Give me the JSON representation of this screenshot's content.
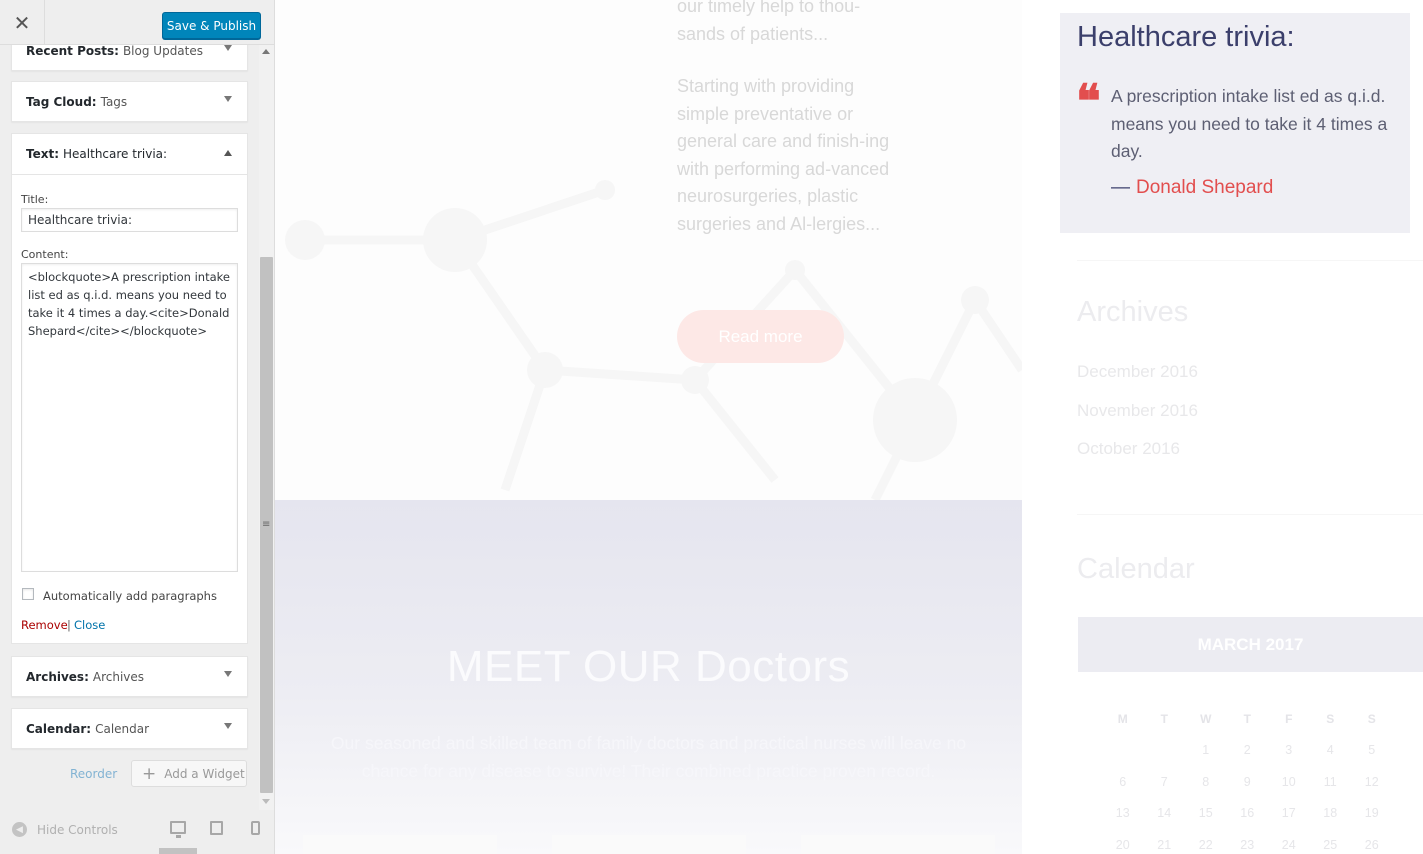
{
  "topbar": {
    "close_glyph": "✕",
    "save_label": "Save & Publish"
  },
  "widgets": {
    "recent_posts": {
      "type": "Recent Posts:",
      "title": "Blog Updates"
    },
    "tag_cloud": {
      "type": "Tag Cloud:",
      "title": "Tags"
    },
    "text": {
      "type": "Text:",
      "title": "Healthcare trivia:",
      "title_label": "Title:",
      "title_value": "Healthcare trivia:",
      "content_label": "Content:",
      "content_value": "<blockquote>A prescription intake list ed as q.i.d. means you need to take it 4 times a day.<cite>Donald Shepard</cite></blockquote>",
      "auto_paragraphs_label": "Automatically add paragraphs",
      "auto_paragraphs_checked": false,
      "remove_label": "Remove",
      "separator": "|",
      "close_label": "Close"
    },
    "archives": {
      "type": "Archives:",
      "title": "Archives"
    },
    "calendar": {
      "type": "Calendar:",
      "title": "Calendar"
    }
  },
  "actions": {
    "reorder_label": "Reorder",
    "add_widget_label": "Add a Widget"
  },
  "footer": {
    "hide_controls_label": "Hide Controls",
    "devices": [
      "desktop-icon",
      "tablet-icon",
      "mobile-icon"
    ],
    "active_device": "desktop"
  },
  "preview": {
    "intro_tail": "our timely help to thou-sands of patients...",
    "intro_body": "Starting with providing simple preventative or general care and finish-ing with performing ad-vanced neurosurgeries, plastic surgeries and Al-lergies...",
    "read_more_label": "Read more",
    "doctors_title": "MEET OUR Doctors",
    "doctors_desc": "Our seasoned and skilled team of family doctors and practical nurses will leave no chance for any disease to survive! Their combined practice proven record.",
    "trivia": {
      "title": "Healthcare trivia:",
      "quote_glyph": "❝",
      "quote": "A prescription intake list ed as q.i.d. means you need to take it 4 times a day.",
      "cite_dash": "—",
      "cite": "Donald Shepard"
    },
    "archives": {
      "title": "Archives",
      "items": [
        "December 2016",
        "November 2016",
        "October 2016"
      ]
    },
    "calendar": {
      "title": "Calendar",
      "month": "MARCH 2017",
      "weekdays": [
        "M",
        "T",
        "W",
        "T",
        "F",
        "S",
        "S"
      ],
      "weeks": [
        [
          "",
          "",
          "1",
          "2",
          "3",
          "4",
          "5"
        ],
        [
          "6",
          "7",
          "8",
          "9",
          "10",
          "11",
          "12"
        ],
        [
          "13",
          "14",
          "15",
          "16",
          "17",
          "18",
          "19"
        ],
        [
          "20",
          "21",
          "22",
          "23",
          "24",
          "25",
          "26"
        ]
      ],
      "today": "23"
    }
  },
  "colors": {
    "primary_button": "#0085ba",
    "remove_link": "#aa0000",
    "close_link": "#0073aa",
    "accent_red": "#e24e4e",
    "heading_navy": "#3b3f6b"
  }
}
